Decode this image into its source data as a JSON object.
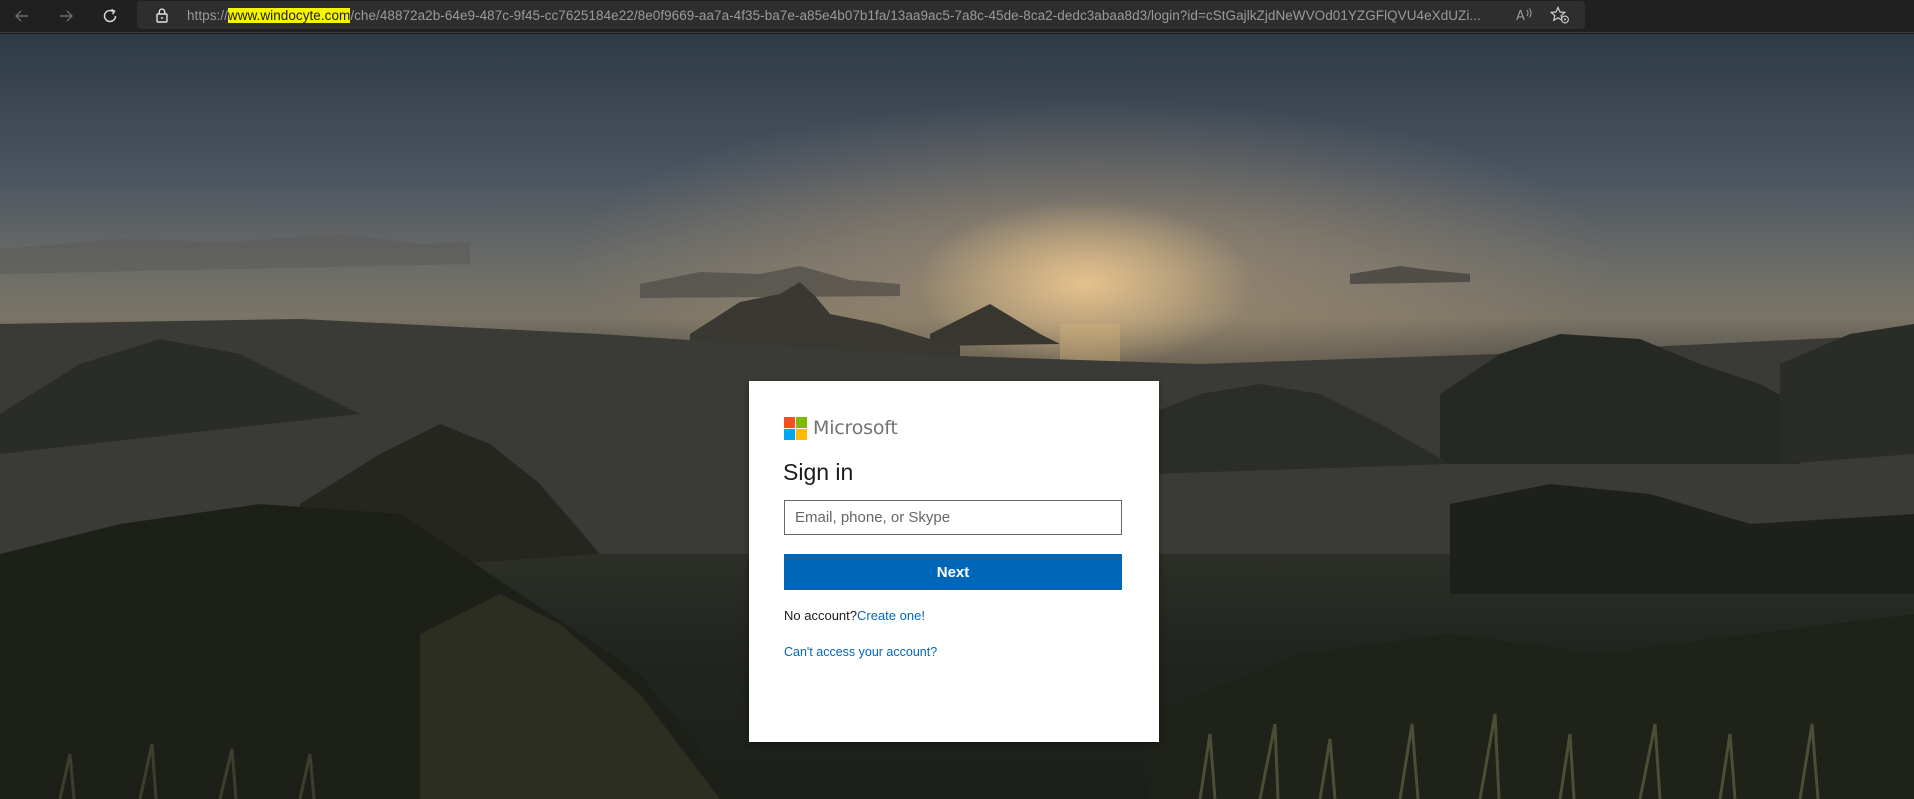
{
  "browser": {
    "url_prefix": "https://",
    "url_domain": "www.windocyte.com",
    "url_path": "/che/48872a2b-64e9-487c-9f45-cc7625184e22/8e0f9669-aa7a-4f35-ba7e-a85e4b07b1fa/13aa9ac5-7a8c-45de-8ca2-dedc3abaa8d3/login?id=cStGajlkZjdNeWVOd01YZGFlQVU4eXdUZi...",
    "icons": {
      "back": "back-arrow-icon",
      "forward": "forward-arrow-icon",
      "reload": "reload-icon",
      "lock": "lock-icon",
      "read_aloud": "read-aloud-icon",
      "favorites": "add-favorite-icon"
    }
  },
  "signin": {
    "brand": "Microsoft",
    "title": "Sign in",
    "email_placeholder": "Email, phone, or Skype",
    "email_value": "",
    "next_label": "Next",
    "no_account_text": "No account?",
    "create_link": "Create one!",
    "cant_access_link": "Can't access your account?"
  },
  "colors": {
    "primary_button": "#0067b8",
    "link": "#0067b8",
    "logo_red": "#f25022",
    "logo_green": "#7fba00",
    "logo_blue": "#00a4ef",
    "logo_yellow": "#ffb900",
    "url_highlight": "#f5f500"
  }
}
